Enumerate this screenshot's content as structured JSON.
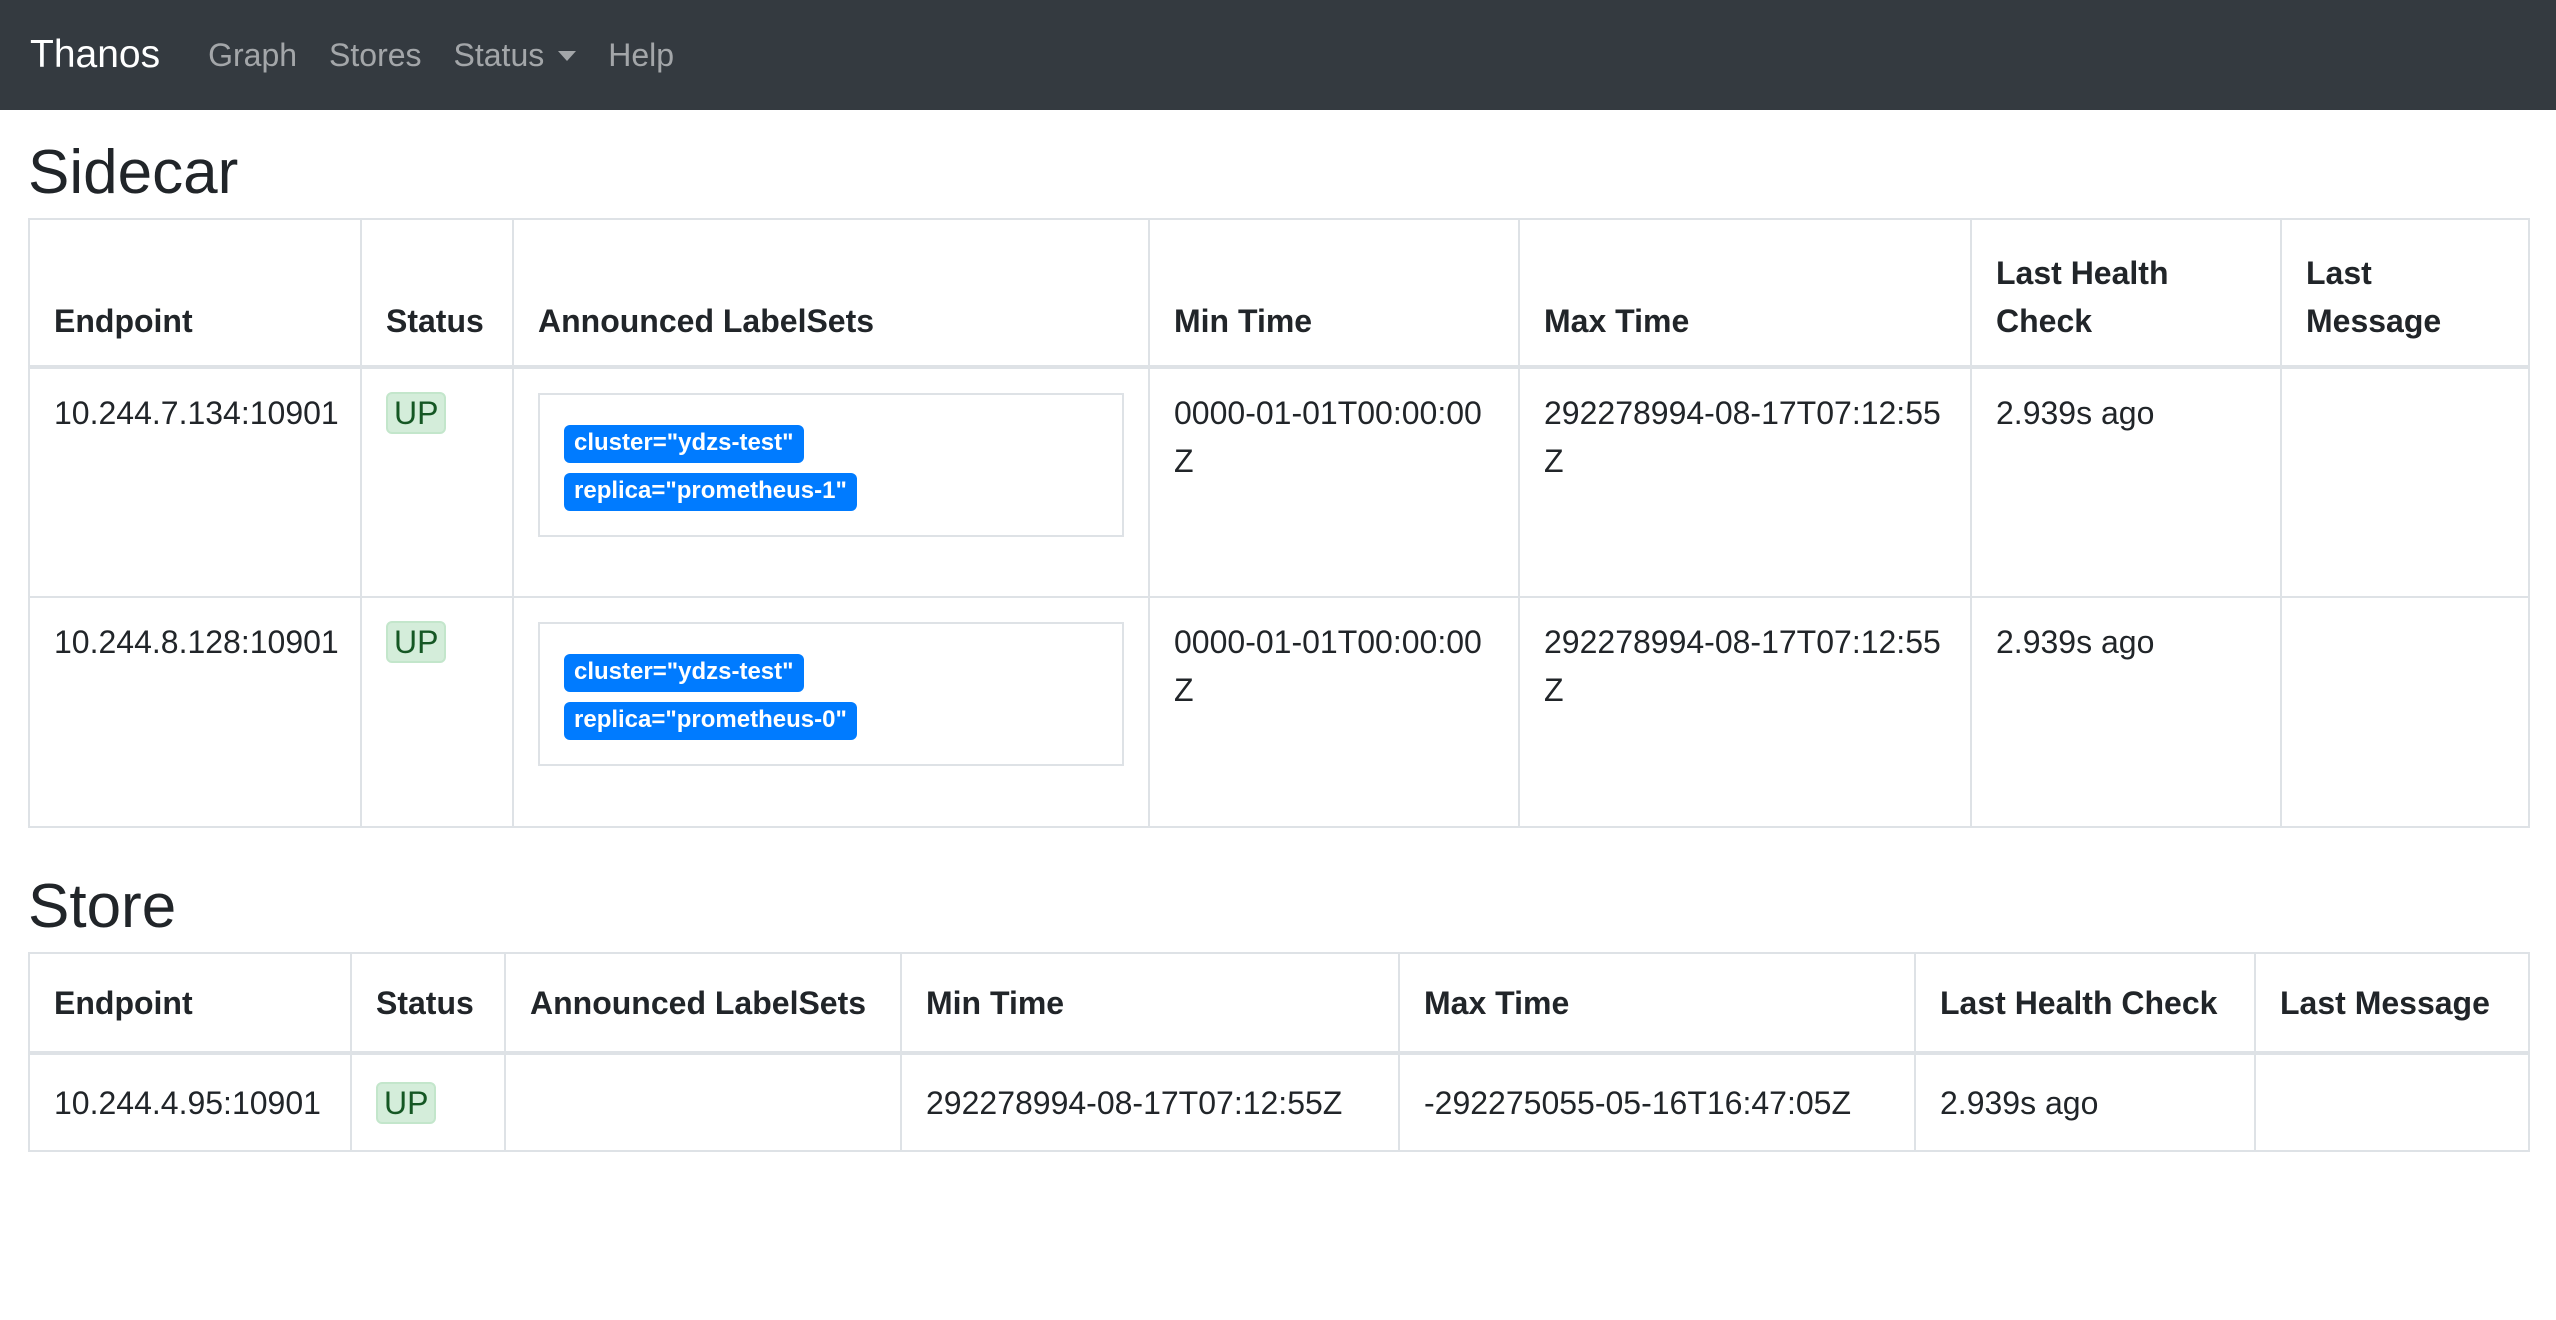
{
  "navbar": {
    "brand": "Thanos",
    "links": [
      {
        "label": "Graph"
      },
      {
        "label": "Stores"
      },
      {
        "label": "Status"
      },
      {
        "label": "Help"
      }
    ]
  },
  "sidecar": {
    "title": "Sidecar",
    "headers": [
      "Endpoint",
      "Status",
      "Announced LabelSets",
      "Min Time",
      "Max Time",
      "Last Health Check",
      "Last Message"
    ],
    "rows": [
      {
        "endpoint": "10.244.7.134:10901",
        "status": "UP",
        "labels": [
          "cluster=\"ydzs-test\"",
          "replica=\"prometheus-1\""
        ],
        "min_time": "0000-01-01T00:00:00Z",
        "max_time": "292278994-08-17T07:12:55Z",
        "last_health_check": "2.939s ago",
        "last_message": ""
      },
      {
        "endpoint": "10.244.8.128:10901",
        "status": "UP",
        "labels": [
          "cluster=\"ydzs-test\"",
          "replica=\"prometheus-0\""
        ],
        "min_time": "0000-01-01T00:00:00Z",
        "max_time": "292278994-08-17T07:12:55Z",
        "last_health_check": "2.939s ago",
        "last_message": ""
      }
    ]
  },
  "store": {
    "title": "Store",
    "headers": [
      "Endpoint",
      "Status",
      "Announced LabelSets",
      "Min Time",
      "Max Time",
      "Last Health Check",
      "Last Message"
    ],
    "rows": [
      {
        "endpoint": "10.244.4.95:10901",
        "status": "UP",
        "min_time": "292278994-08-17T07:12:55Z",
        "max_time": "-292275055-05-16T16:47:05Z",
        "last_health_check": "2.939s ago",
        "last_message": ""
      }
    ]
  },
  "colors": {
    "navbar_bg": "#343a40",
    "label_badge": "#007bff",
    "status_up_bg": "#d4edda",
    "status_up_text": "#155724"
  }
}
